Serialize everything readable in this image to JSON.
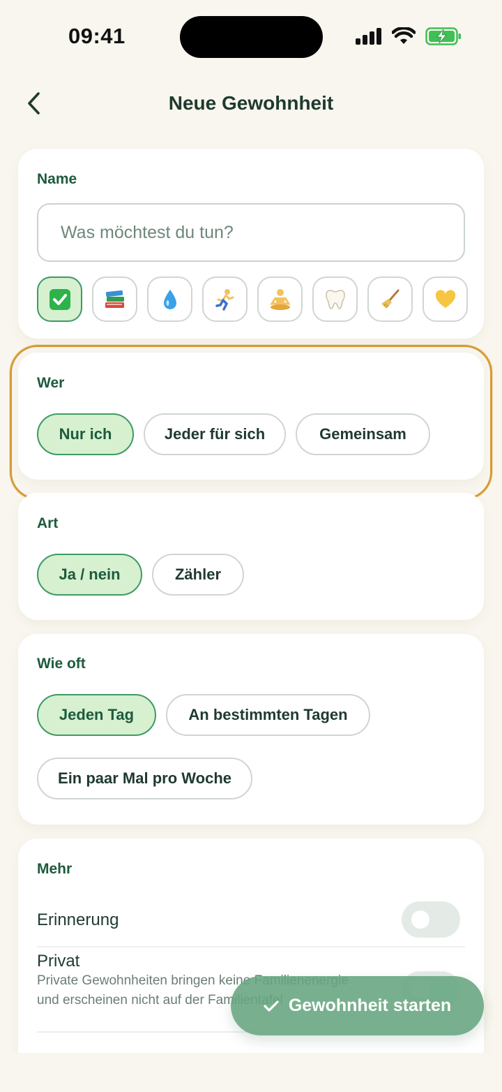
{
  "status_bar": {
    "time": "09:41"
  },
  "header": {
    "title": "Neue Gewohnheit"
  },
  "name_section": {
    "label": "Name",
    "input_value": "",
    "placeholder": "Was möchtest du tun?",
    "emojis": [
      "✅",
      "📚",
      "💧",
      "🏃",
      "🧘",
      "🦷",
      "🧹",
      "💛"
    ],
    "selected_emoji_index": 0
  },
  "wer_section": {
    "label": "Wer",
    "options": [
      "Nur ich",
      "Jeder für sich",
      "Gemeinsam"
    ],
    "selected_index": 0
  },
  "art_section": {
    "label": "Art",
    "options": [
      "Ja / nein",
      "Zähler"
    ],
    "selected_index": 0
  },
  "wie_oft_section": {
    "label": "Wie oft",
    "options": [
      "Jeden Tag",
      "An bestimmten Tagen",
      "Ein paar Mal pro Woche"
    ],
    "selected_index": 0
  },
  "mehr_section": {
    "label": "Mehr",
    "reminder": {
      "label": "Erinnerung",
      "enabled": false
    },
    "private": {
      "label": "Privat",
      "description": "Private Gewohnheiten bringen keine Familienenergie und erscheinen nicht auf der Familientafel",
      "enabled": false
    }
  },
  "cta": {
    "label": "Gewohnheit starten"
  },
  "colors": {
    "accent_green": "#3d9a63",
    "selected_chip": "#d6f0d0",
    "highlight": "#d69a35",
    "cta": "#65a580"
  }
}
